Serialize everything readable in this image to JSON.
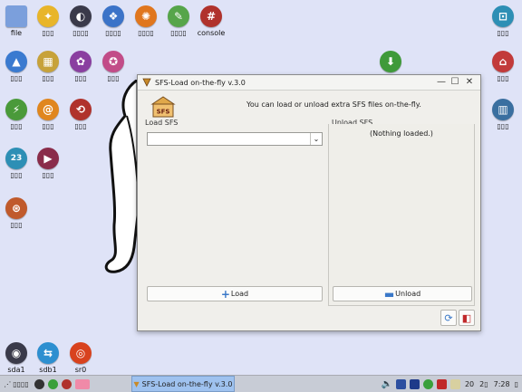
{
  "desktop": {
    "icons": [
      {
        "name": "file-icon",
        "label": "file",
        "glyph": "▬",
        "color": "#6a8fd0"
      },
      {
        "name": "help-icon",
        "label": "▯▯▯",
        "glyph": "✦",
        "color": "#e8b52a"
      },
      {
        "name": "setup-icon",
        "label": "▯▯▯▯",
        "glyph": "◐",
        "color": "#3a3a4a"
      },
      {
        "name": "dropbox-icon",
        "label": "▯▯▯▯",
        "glyph": "❖",
        "color": "#3b73c8"
      },
      {
        "name": "gear-icon",
        "label": "▯▯▯▯",
        "glyph": "✺",
        "color": "#e0761e"
      },
      {
        "name": "edit-icon",
        "label": "▯▯▯▯",
        "glyph": "✎",
        "color": "#56a54a"
      },
      {
        "name": "console-icon",
        "label": "console",
        "glyph": "#",
        "color": "#b0322c"
      },
      {
        "name": "lock-icon",
        "label": "▯▯▯",
        "glyph": "🔒",
        "color": "#2d8fb5"
      },
      {
        "name": "install-icon",
        "label": "▯▯▯",
        "glyph": "▲",
        "color": "#3a7ad0"
      },
      {
        "name": "apps-icon",
        "label": "▯▯▯",
        "glyph": "▦",
        "color": "#c7a23a"
      },
      {
        "name": "paint-icon",
        "label": "▯▯▯",
        "glyph": "✿",
        "color": "#8a3fa0"
      },
      {
        "name": "puppy-icon",
        "label": "▯▯▯",
        "glyph": "✪",
        "color": "#c24c88"
      },
      {
        "name": "download-icon",
        "label": "",
        "glyph": "⬇",
        "color": "#3f9a3a"
      },
      {
        "name": "home-icon",
        "label": "▯▯▯",
        "glyph": "⌂",
        "color": "#c23a3a"
      },
      {
        "name": "connect-icon",
        "label": "▯▯▯",
        "glyph": "⚡",
        "color": "#4a9a3a"
      },
      {
        "name": "email-icon",
        "label": "▯▯▯",
        "glyph": "@",
        "color": "#e0861e"
      },
      {
        "name": "chat-icon",
        "label": "▯▯▯",
        "glyph": "⟲",
        "color": "#b0322c"
      },
      {
        "name": "trash-icon",
        "label": "▯▯▯",
        "glyph": "▥",
        "color": "#3a6fa0"
      },
      {
        "name": "calendar-icon",
        "label": "▯▯▯",
        "glyph": "23",
        "color": "#2d8fb5"
      },
      {
        "name": "media-icon",
        "label": "▯▯▯",
        "glyph": "▶",
        "color": "#8a2c4a"
      },
      {
        "name": "satellite-icon",
        "label": "▯▯▯",
        "glyph": "⊛",
        "color": "#c05a2c"
      },
      {
        "name": "drive-sda1-icon",
        "label": "sda1",
        "glyph": "◉",
        "color": "#3a3a4a"
      },
      {
        "name": "drive-sdb1-icon",
        "label": "sdb1",
        "glyph": "⇆",
        "color": "#2d8fd0"
      },
      {
        "name": "drive-sr0-icon",
        "label": "sr0",
        "glyph": "◎",
        "color": "#d8421e"
      }
    ]
  },
  "window": {
    "title": "SFS-Load on-the-fly v.3.0",
    "minimize": "—",
    "maximize": "☐",
    "close": "✕",
    "logo_text": "SFS",
    "message": "You can load or unload extra SFS files on-the-fly.",
    "load_panel_title": "Load SFS",
    "unload_panel_title": "Unload SFS",
    "combo_value": "",
    "nothing_loaded": "(Nothing loaded.)",
    "load_button": "Load",
    "unload_button": "Unload"
  },
  "taskbar": {
    "menu_label": "▯▯▯▯",
    "task_title": "SFS-Load on-the-fly v.3.0",
    "tray_text": "20",
    "day": "2▯",
    "clock": "7:28",
    "end_label": "▯"
  }
}
